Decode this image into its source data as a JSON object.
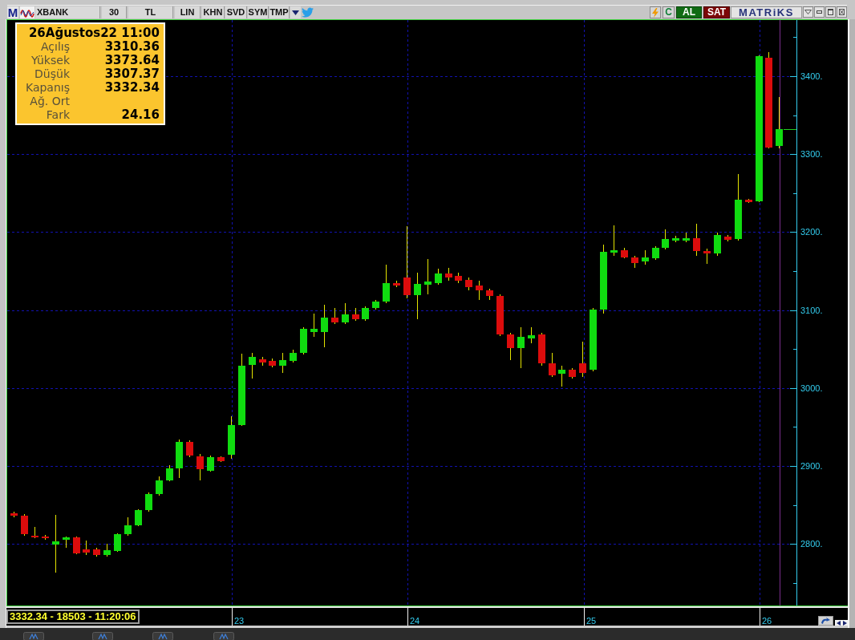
{
  "toolbar": {
    "logo": "M",
    "fields": [
      {
        "kind": "symbol",
        "value": "XBANK"
      },
      {
        "kind": "period",
        "value": "30"
      },
      {
        "kind": "currency",
        "value": "TL"
      }
    ],
    "buttons": [
      "LIN",
      "KHN",
      "SVD",
      "SYM",
      "TMP"
    ]
  },
  "trade_bar": {
    "buttons": [
      {
        "kind": "plain",
        "label": "C"
      },
      {
        "kind": "buy",
        "label": "AL"
      },
      {
        "kind": "sell",
        "label": "SAT"
      }
    ],
    "brand": "MATRiKS"
  },
  "info_box": {
    "title": "26Ağustos22 11:00",
    "rows": [
      {
        "label": "Açılış",
        "value": "3310.36"
      },
      {
        "label": "Yüksek",
        "value": "3373.64"
      },
      {
        "label": "Düşük",
        "value": "3307.37"
      },
      {
        "label": "Kapanış",
        "value": "3332.34"
      },
      {
        "label": "Ağ. Ort"
      },
      {
        "label": "Fark",
        "value": "24.16"
      }
    ]
  },
  "chart": {
    "chart_data": {
      "type": "candlestick",
      "x": [
        21.719,
        21.778,
        21.837,
        21.895,
        21.954,
        22.013,
        22.072,
        22.131,
        22.189,
        22.248,
        22.307,
        22.366,
        22.425,
        22.483,
        22.542,
        22.601,
        22.66,
        22.719,
        22.777,
        22.836,
        22.895,
        22.954,
        23.013,
        23.071,
        23.13,
        23.189,
        23.248,
        23.307,
        23.365,
        23.424,
        23.483,
        23.542,
        23.601,
        23.659,
        23.718,
        23.777,
        23.836,
        23.895,
        23.953,
        24.012,
        24.071,
        24.13,
        24.189,
        24.247,
        24.306,
        24.365,
        24.424,
        24.483,
        24.541,
        24.6,
        24.659,
        24.718,
        24.777,
        24.835,
        24.894,
        24.953,
        25.012,
        25.071,
        25.129,
        25.188,
        25.247,
        25.306,
        25.365,
        25.423,
        25.482,
        25.541,
        25.6,
        25.659,
        25.717,
        25.776,
        25.835,
        25.894,
        25.953,
        26.011,
        26.07
      ],
      "ohlc": [
        [
          2839,
          2841,
          2834,
          2836
        ],
        [
          2836,
          2838,
          2811,
          2813
        ],
        [
          2811,
          2822,
          2807,
          2808
        ],
        [
          2810,
          2812,
          2805,
          2807
        ],
        [
          2799,
          2837,
          2763,
          2803
        ],
        [
          2805,
          2810,
          2795,
          2808
        ],
        [
          2808,
          2810,
          2787,
          2788
        ],
        [
          2793,
          2804,
          2786,
          2789
        ],
        [
          2793,
          2795,
          2784,
          2786
        ],
        [
          2786,
          2800,
          2784,
          2792
        ],
        [
          2791,
          2814,
          2790,
          2813
        ],
        [
          2813,
          2834,
          2811,
          2824
        ],
        [
          2824,
          2845,
          2823,
          2843
        ],
        [
          2843,
          2866,
          2841,
          2864
        ],
        [
          2864,
          2887,
          2862,
          2882
        ],
        [
          2882,
          2901,
          2880,
          2897
        ],
        [
          2897,
          2934,
          2885,
          2931
        ],
        [
          2931,
          2933,
          2911,
          2913
        ],
        [
          2912,
          2915,
          2882,
          2896
        ],
        [
          2894,
          2913,
          2893,
          2911
        ],
        [
          2911,
          2912,
          2905,
          2906
        ],
        [
          2914,
          2964,
          2909,
          2952
        ],
        [
          2952,
          3044,
          2951,
          3029
        ],
        [
          3030,
          3045,
          3012,
          3040
        ],
        [
          3037,
          3040,
          3029,
          3033
        ],
        [
          3035,
          3038,
          3027,
          3029
        ],
        [
          3029,
          3045,
          3019,
          3036
        ],
        [
          3035,
          3049,
          3033,
          3045
        ],
        [
          3045,
          3078,
          3043,
          3076
        ],
        [
          3072,
          3096,
          3066,
          3076
        ],
        [
          3072,
          3107,
          3052,
          3090
        ],
        [
          3090,
          3103,
          3082,
          3084
        ],
        [
          3084,
          3109,
          3082,
          3094
        ],
        [
          3094,
          3103,
          3086,
          3088
        ],
        [
          3088,
          3105,
          3086,
          3103
        ],
        [
          3103,
          3113,
          3101,
          3111
        ],
        [
          3111,
          3158,
          3109,
          3135
        ],
        [
          3135,
          3138,
          3129,
          3131
        ],
        [
          3142,
          3208,
          3115,
          3119
        ],
        [
          3119,
          3148,
          3088,
          3134
        ],
        [
          3133,
          3165,
          3120,
          3137
        ],
        [
          3135,
          3153,
          3133,
          3147
        ],
        [
          3147,
          3154,
          3138,
          3142
        ],
        [
          3144,
          3148,
          3135,
          3138
        ],
        [
          3139,
          3142,
          3125,
          3129
        ],
        [
          3131,
          3138,
          3113,
          3125
        ],
        [
          3125,
          3127,
          3113,
          3118
        ],
        [
          3118,
          3120,
          3067,
          3069
        ],
        [
          3069,
          3071,
          3036,
          3051
        ],
        [
          3051,
          3078,
          3026,
          3066
        ],
        [
          3064,
          3078,
          3057,
          3068
        ],
        [
          3069,
          3071,
          3029,
          3032
        ],
        [
          3032,
          3045,
          3014,
          3016
        ],
        [
          3018,
          3029,
          3002,
          3024
        ],
        [
          3024,
          3026,
          3012,
          3014
        ],
        [
          3032,
          3059,
          3014,
          3019
        ],
        [
          3023,
          3103,
          3021,
          3101
        ],
        [
          3101,
          3184,
          3096,
          3175
        ],
        [
          3174,
          3209,
          3170,
          3177
        ],
        [
          3177,
          3180,
          3166,
          3168
        ],
        [
          3168,
          3170,
          3154,
          3160
        ],
        [
          3162,
          3177,
          3158,
          3168
        ],
        [
          3166,
          3182,
          3164,
          3180
        ],
        [
          3180,
          3204,
          3178,
          3191
        ],
        [
          3189,
          3195,
          3187,
          3192
        ],
        [
          3189,
          3199,
          3187,
          3192
        ],
        [
          3192,
          3211,
          3170,
          3176
        ],
        [
          3176,
          3179,
          3159,
          3173
        ],
        [
          3173,
          3199,
          3170,
          3196
        ],
        [
          3194,
          3196,
          3188,
          3190
        ],
        [
          3191,
          3275,
          3189,
          3242
        ],
        [
          3242,
          3243,
          3237,
          3238
        ],
        [
          3240,
          3427,
          3239,
          3426
        ],
        [
          3424,
          3431,
          3307,
          3308
        ],
        [
          3310.36,
          3373.64,
          3307.37,
          3332.34
        ]
      ],
      "xlim": [
        21.682,
        26.461
      ],
      "ylim": [
        2719,
        3472
      ],
      "grid": true,
      "yticks": [
        {
          "value": 3400,
          "label": "3400."
        },
        {
          "value": 3300,
          "label": "3300."
        },
        {
          "value": 3200,
          "label": "3200."
        },
        {
          "value": 3100,
          "label": "3100."
        },
        {
          "value": 3000,
          "label": "3000."
        },
        {
          "value": 2900,
          "label": "2900."
        },
        {
          "value": 2800,
          "label": "2800."
        }
      ],
      "xticks": [
        23,
        24,
        25,
        26
      ],
      "ref_lines": [
        {
          "axis": "x",
          "value": 26.075
        }
      ]
    }
  },
  "status_bar": {
    "text": "3332.34 - 18503 - 11:20:06"
  }
}
